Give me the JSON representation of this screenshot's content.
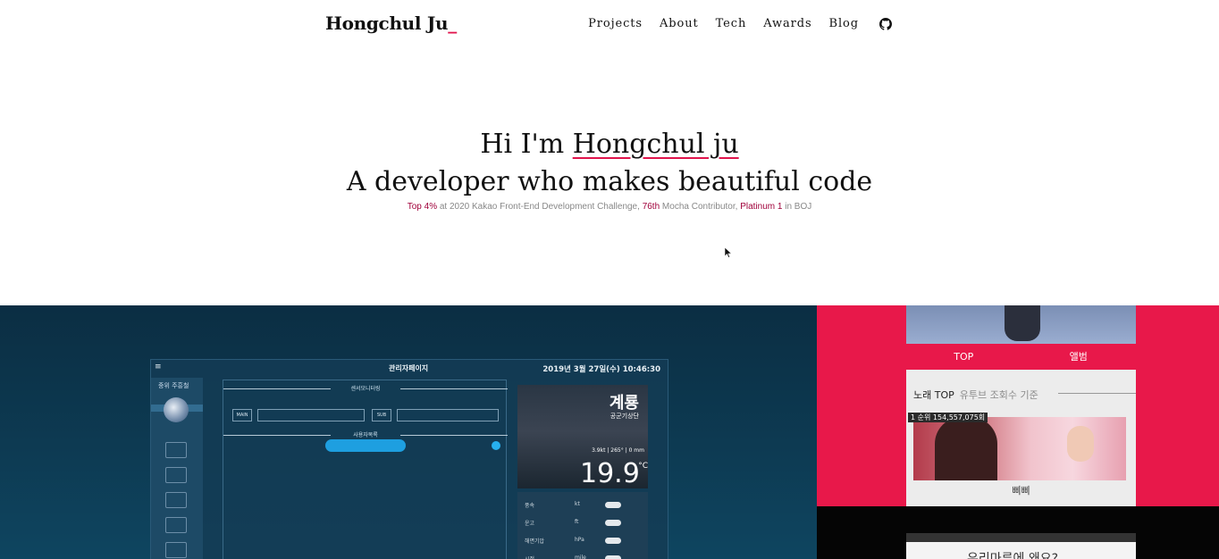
{
  "nav": {
    "brand": "Hongchul Ju",
    "brand_cursor": "_",
    "links": [
      "Projects",
      "About",
      "Tech",
      "Awards",
      "Blog"
    ],
    "github_icon": "github-icon"
  },
  "hero": {
    "greeting_prefix": "Hi I'm ",
    "name": "Hongchul ju",
    "tagline": "A developer who makes beautiful code",
    "sub": {
      "hl1": "Top 4%",
      "t1": " at 2020 Kakao Front-End Development Challenge, ",
      "hl2": "76th",
      "t2": " Mocha Contributor, ",
      "hl3": "Platinum 1",
      "t3": " in BOJ"
    }
  },
  "projects": {
    "dashboard": {
      "menu_icon": "≡",
      "title": "관리자페이지",
      "datetime": "2019년 3월 27일(수) 10:46:30",
      "side_name": "중위 주흥철",
      "sensor_header": "센서모니터링",
      "search_header": "사용자목록",
      "main_label": "MAIN",
      "sub_label": "SUB",
      "weather_place": "계룡",
      "weather_place_sub": "공군기상단",
      "weather_meta": "3.9kt | 265° | 0 mm",
      "temperature": "19.9",
      "temp_unit": "°C",
      "rows": [
        {
          "label": "풍속",
          "unit": "kt"
        },
        {
          "label": "운고",
          "unit": "ft"
        },
        {
          "label": "해면기압",
          "unit": "hPa"
        },
        {
          "label": "시정",
          "unit": "mile"
        }
      ]
    },
    "music": {
      "tab_top": "TOP",
      "tab_album": "앨범",
      "section_title": "노래 TOP",
      "section_muted": "유투브 조회수 기준",
      "rank_badge": "1 순위 154,557,075회",
      "song": "삐삐"
    },
    "second_app": {
      "text": "우리마루에 왜요?"
    }
  },
  "colors": {
    "accent": "#e0144c",
    "dark_panel": "#0d3a52",
    "red_panel": "#e8184a"
  }
}
